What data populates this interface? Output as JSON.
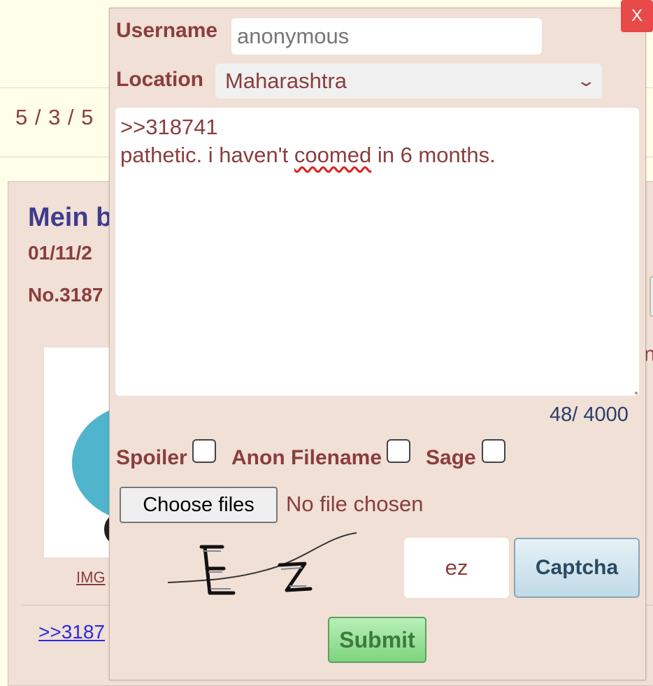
{
  "background": {
    "page_counter": "5 / 3 / 5",
    "post": {
      "title": "Mein b",
      "date": "01/11/2",
      "number": "No.3187",
      "image_link": "IMG",
      "quote_link": ">>3187",
      "side_fragment": "n"
    }
  },
  "quick_reply": {
    "close_label": "X",
    "username": {
      "label": "Username",
      "value": "anonymous"
    },
    "location": {
      "label": "Location",
      "selected": "Maharashtra"
    },
    "comment": {
      "line1": ">>318741",
      "line2_pre": "pathetic. i haven't ",
      "line2_misspelled": "coomed",
      "line2_post": " in 6 months."
    },
    "char_counter": "48/ 4000",
    "options": {
      "spoiler_label": "Spoiler",
      "anon_filename_label": "Anon Filename",
      "sage_label": "Sage"
    },
    "file": {
      "button_label": "Choose files",
      "status": "No file chosen"
    },
    "captcha": {
      "input_value": "ez",
      "button_label": "Captcha"
    },
    "submit_label": "Submit"
  },
  "colors": {
    "page_bg": "#fefee9",
    "panel_bg": "#f0e0d6",
    "label_color": "#8b3d3d",
    "close_bg": "#e84a4a",
    "submit_bg": "#7ed47e",
    "captcha_btn_bg": "#c0dae7"
  }
}
